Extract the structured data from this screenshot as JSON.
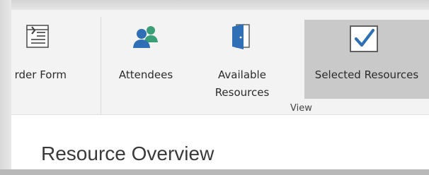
{
  "ribbon": {
    "buttons": {
      "order_form": {
        "label": "rder Form",
        "icon": "order-form-icon"
      },
      "attendees": {
        "label": "Attendees",
        "icon": "attendees-icon"
      },
      "available_resources": {
        "label": "Available Resources",
        "icon": "door-icon"
      },
      "selected_resources": {
        "label": "Selected Resources",
        "icon": "checkbox-icon",
        "active": true
      }
    },
    "group_label": "View"
  },
  "content": {
    "title": "Resource Overview"
  },
  "colors": {
    "ribbon_bg": "#f3f3f3",
    "active_button_bg": "#c9c9c9",
    "icon_blue": "#2e6fb5",
    "icon_green": "#3a9f77"
  }
}
